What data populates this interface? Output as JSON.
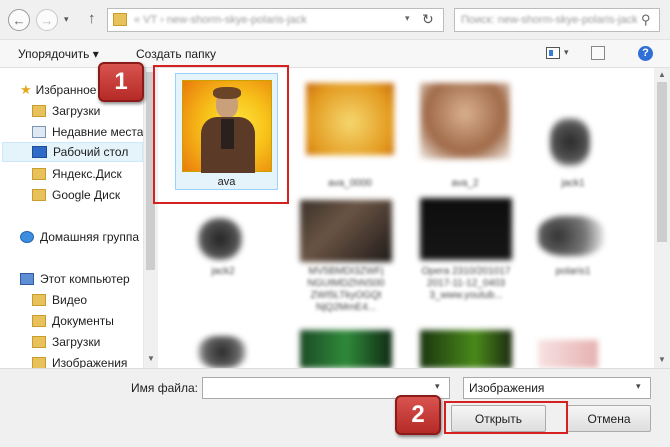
{
  "address": {
    "path": "«  VT  ›  new-shorm-skye-polaris-jack",
    "search_placeholder": "Поиск: new-shorm-skye-polaris-jack"
  },
  "toolbar": {
    "organize": "Упорядочить ▾",
    "new_folder": "Создать папку"
  },
  "nav": {
    "favorites": "Избранное",
    "downloads": "Загрузки",
    "recent": "Недавние места",
    "desktop": "Рабочий стол",
    "yandex": "Яндекс.Диск",
    "google": "Google Диск",
    "homegroup": "Домашняя группа",
    "computer": "Этот компьютер",
    "video": "Видео",
    "documents": "Документы",
    "downloads2": "Загрузки",
    "images": "Изображения"
  },
  "files": [
    {
      "name": "ava"
    },
    {
      "name": "ava_0000"
    },
    {
      "name": "ava_2"
    },
    {
      "name": "jack1"
    },
    {
      "name": "jack2"
    },
    {
      "name": "MV5BMDI3ZWFj NGUtMDZhNS00 ZWI5LTkyOGQt NjQ2MmE4..."
    },
    {
      "name": "Opera 2310/201017 2017-11-12_0403 3_www.youtub..."
    },
    {
      "name": "polaris1"
    }
  ],
  "footer": {
    "filename_label": "Имя файла:",
    "filename_value": "",
    "filter_value": "Изображения",
    "open_label": "Открыть",
    "cancel_label": "Отмена"
  },
  "callouts": {
    "one": "1",
    "two": "2"
  },
  "colors": {
    "highlight_red": "#d42020",
    "selection_blue": "#cce8ff"
  }
}
